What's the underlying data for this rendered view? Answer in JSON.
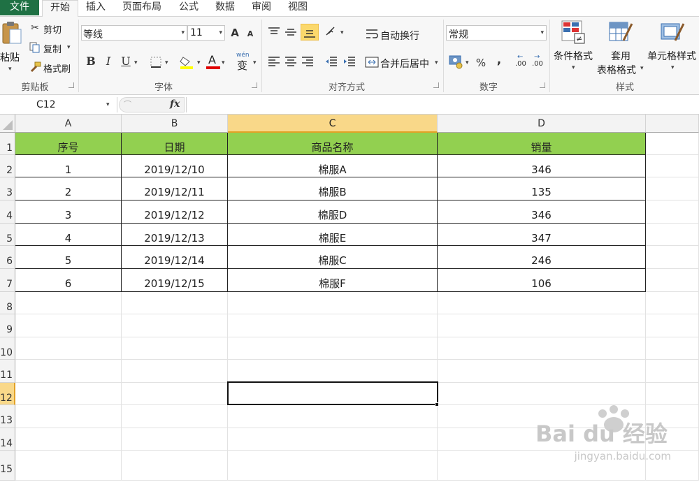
{
  "tabs": {
    "file": "文件",
    "home": "开始",
    "insert": "插入",
    "page_layout": "页面布局",
    "formulas": "公式",
    "data": "数据",
    "review": "审阅",
    "view": "视图"
  },
  "clipboard": {
    "paste": "粘贴",
    "cut": "剪切",
    "copy": "复制",
    "format_painter": "格式刷",
    "group": "剪贴板"
  },
  "font": {
    "name": "等线",
    "size": "11",
    "bold": "B",
    "italic": "I",
    "underline": "U",
    "grow": "A",
    "shrink": "A",
    "font_color_glyph": "A",
    "phonetic": "wén",
    "phonetic_char": "变",
    "group": "字体"
  },
  "alignment": {
    "wrap": "自动换行",
    "merge": "合并后居中",
    "group": "对齐方式"
  },
  "number": {
    "format": "常规",
    "percent": "%",
    "comma": ",",
    "inc_decimal": ".00",
    "dec_decimal": ".00",
    "group": "数字"
  },
  "styles": {
    "conditional": "条件格式",
    "table_format_1": "套用",
    "table_format_2": "表格格式",
    "cell_styles": "单元格样式",
    "group": "样式"
  },
  "formula_bar": {
    "name_box": "C12",
    "fx": "fx",
    "value": ""
  },
  "columns": [
    "A",
    "B",
    "C",
    "D"
  ],
  "rows": [
    "1",
    "2",
    "3",
    "4",
    "5",
    "6",
    "7",
    "8",
    "9",
    "10",
    "11",
    "12",
    "13",
    "14",
    "15"
  ],
  "table": {
    "headers": [
      "序号",
      "日期",
      "商品名称",
      "销量"
    ],
    "data": [
      [
        "1",
        "2019/12/10",
        "棉服A",
        "346"
      ],
      [
        "2",
        "2019/12/11",
        "棉服B",
        "135"
      ],
      [
        "3",
        "2019/12/12",
        "棉服D",
        "346"
      ],
      [
        "4",
        "2019/12/13",
        "棉服E",
        "347"
      ],
      [
        "5",
        "2019/12/14",
        "棉服C",
        "246"
      ],
      [
        "6",
        "2019/12/15",
        "棉服F",
        "106"
      ]
    ]
  },
  "selected_cell": "C12",
  "colors": {
    "header_fill": "#92d050",
    "file_tab": "#1f7144",
    "selected_col_header": "#f9d889"
  },
  "watermark": {
    "main": "Bai du 经验",
    "sub": "jingyan.baidu.com"
  }
}
